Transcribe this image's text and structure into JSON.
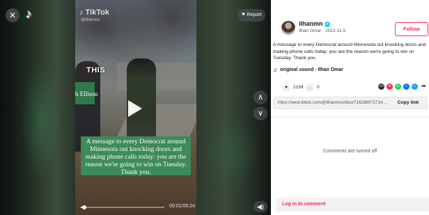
{
  "video": {
    "watermark_logo": "♪",
    "watermark_name": "TikTok",
    "watermark_user": "@ilhanmn",
    "overlay_word": "THIS",
    "yard_sign_text": "h Ellison",
    "caption": "A message to every Democrat around Minnesota out knocking doors and making phone calls today: you are the reason we're going to win on Tuesday. Thank you.",
    "time": "00:01/00:24",
    "progress": 0.04,
    "report_label": "Report",
    "controls": {
      "close": "✕",
      "logo": "♪",
      "report_flag": "⚑",
      "prev": "∧",
      "next": "∨",
      "mute": "◀)"
    }
  },
  "author": {
    "username": "ilhanmn",
    "verified": true,
    "display_name": "Ilhan Omar",
    "date": "2022-11-5",
    "follow_label": "Follow"
  },
  "post": {
    "description": "A message to every Democrat around Minnesota out knocking doors and making phone calls today: you are the reason we're going to win on Tuesday. Thank you.",
    "sound": "original sound - Ilhan Omar",
    "likes": "2159",
    "comments": "0",
    "link": "https://www.tiktok.com/@ilhanmn/video/716286972714212...",
    "copy_label": "Copy link"
  },
  "share_icons": [
    {
      "name": "embed-icon",
      "glyph": "</>",
      "color": "#2f2f2f"
    },
    {
      "name": "pocket-icon",
      "glyph": "▼",
      "color": "#fe2c55"
    },
    {
      "name": "whatsapp-icon",
      "glyph": "✆",
      "color": "#25d366"
    },
    {
      "name": "facebook-icon",
      "glyph": "f",
      "color": "#0075fa"
    },
    {
      "name": "twitter-icon",
      "glyph": "t",
      "color": "#1da1f2"
    }
  ],
  "comments_off_text": "Comments are turned off",
  "login_text": "Log in to comment",
  "colors": {
    "accent": "#fe2c55",
    "verified": "#20d5ec",
    "caption_bg": "#3d8a5a"
  }
}
